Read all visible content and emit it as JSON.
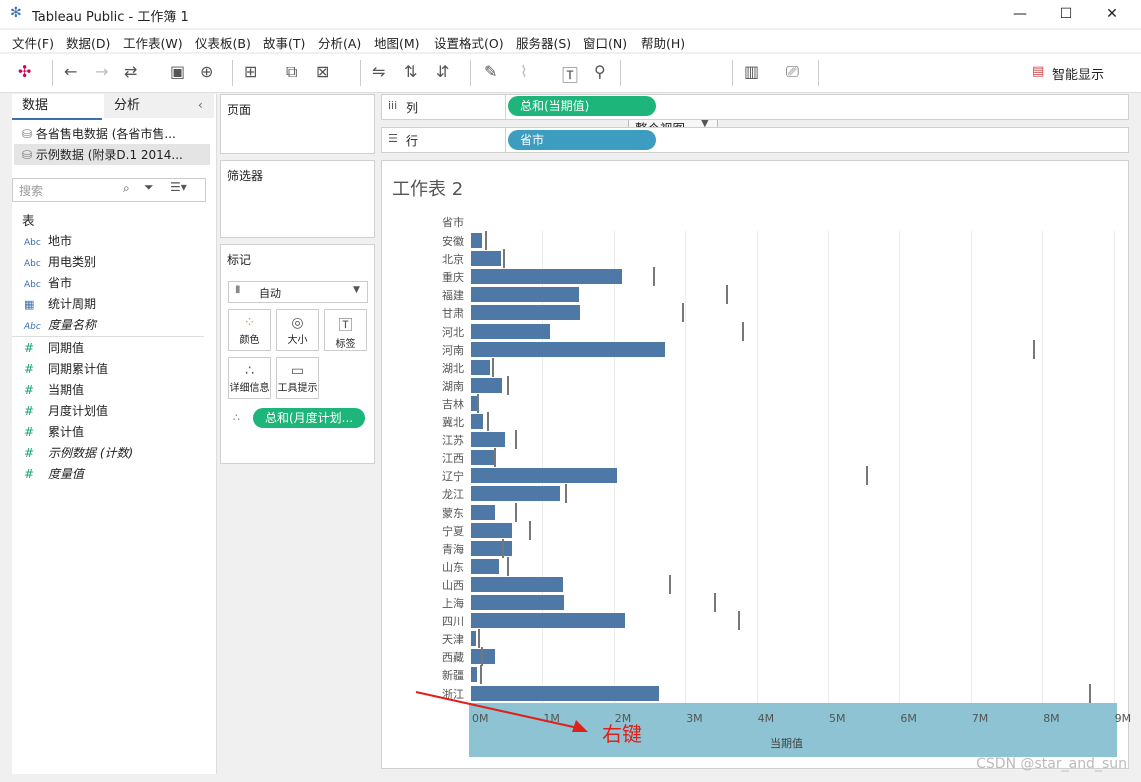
{
  "window": {
    "title": "Tableau Public - 工作簿 1"
  },
  "menu": [
    "文件(F)",
    "数据(D)",
    "工作表(W)",
    "仪表板(B)",
    "故事(T)",
    "分析(A)",
    "地图(M)",
    "设置格式(O)",
    "服务器(S)",
    "窗口(N)",
    "帮助(H)"
  ],
  "toolbar": {
    "fit_label": "整个视图",
    "show_me_label": "智能显示"
  },
  "data_pane": {
    "tab_data": "数据",
    "tab_analysis": "分析",
    "datasources": [
      "各省售电数据 (各省市售...",
      "示例数据 (附录D.1 2014..."
    ],
    "search_placeholder": "搜索",
    "section_table": "表",
    "dimensions": [
      {
        "icon": "Abc",
        "label": "地市"
      },
      {
        "icon": "Abc",
        "label": "用电类别"
      },
      {
        "icon": "Abc",
        "label": "省市"
      },
      {
        "icon": "calendar-icon",
        "label": "统计周期"
      },
      {
        "icon": "Abc",
        "label": "度量名称"
      }
    ],
    "measures": [
      "同期值",
      "同期累计值",
      "当期值",
      "月度计划值",
      "累计值",
      "示例数据 (计数)",
      "度量值"
    ]
  },
  "cards": {
    "pages": "页面",
    "filters": "筛选器",
    "marks": "标记",
    "mark_type": "自动",
    "mark_buttons": [
      "颜色",
      "大小",
      "标签",
      "详细信息",
      "工具提示"
    ],
    "mark_pill": "总和(月度计划..."
  },
  "shelves": {
    "columns_label": "列",
    "columns_pill": "总和(当期值)",
    "rows_label": "行",
    "rows_pill": "省市"
  },
  "viz": {
    "sheet_title": "工作表 2"
  },
  "annotation": {
    "text": "右键"
  },
  "watermark": "CSDN @star_and_sun",
  "colors": {
    "bar": "#4e79a7",
    "pill_green": "#1db57a",
    "pill_blue": "#3d9dc1",
    "axis_highlight": "#8ec3d3",
    "arrow": "#e0201a"
  },
  "chart_data": {
    "type": "bar",
    "ylabel": "省市",
    "xlabel": "当期值",
    "xticks": [
      "0M",
      "1M",
      "2M",
      "3M",
      "4M",
      "5M",
      "6M",
      "7M",
      "8M",
      "9M"
    ],
    "xlim": [
      0,
      9000000
    ],
    "categories": [
      "安徽",
      "北京",
      "重庆",
      "福建",
      "甘肃",
      "河北",
      "河南",
      "湖北",
      "湖南",
      "吉林",
      "冀北",
      "江苏",
      "江西",
      "辽宁",
      "龙江",
      "蒙东",
      "宁夏",
      "青海",
      "山东",
      "山西",
      "上海",
      "四川",
      "天津",
      "西藏",
      "新疆",
      "浙江"
    ],
    "series": [
      {
        "name": "总和(当期值)",
        "values": [
          160000,
          420000,
          2120000,
          1510000,
          1530000,
          1100000,
          2720000,
          260000,
          440000,
          80000,
          170000,
          480000,
          350000,
          2050000,
          1250000,
          340000,
          570000,
          580000,
          390000,
          1290000,
          1300000,
          2160000,
          70000,
          340000,
          90000,
          2640000
        ]
      },
      {
        "name": "总和(月度计划值)",
        "values": [
          200000,
          450000,
          2550000,
          3570000,
          2960000,
          3790000,
          7870000,
          300000,
          500000,
          90000,
          230000,
          620000,
          320000,
          5530000,
          1310000,
          620000,
          810000,
          430000,
          500000,
          2780000,
          3400000,
          3740000,
          100000,
          140000,
          120000,
          8660000
        ]
      }
    ]
  }
}
